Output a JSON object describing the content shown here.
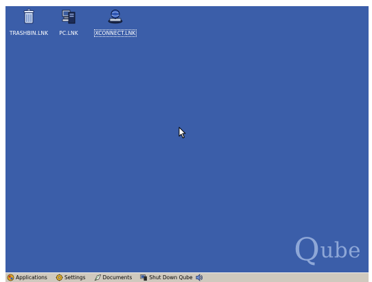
{
  "desktop": {
    "background_color": "#3b5ea9",
    "brand_text_q": "Q",
    "brand_text_rest": "ube",
    "icons": [
      {
        "label": "TRASHBIN.LNK",
        "icon": "trash-bin-icon"
      },
      {
        "label": "PC.LNK",
        "icon": "pc-icon"
      },
      {
        "label": "XCONNECT.LNK",
        "icon": "network-connect-icon",
        "selected": true
      }
    ]
  },
  "taskbar": {
    "items": [
      {
        "label": "Applications",
        "icon": "applications-icon"
      },
      {
        "label": "Settings",
        "icon": "settings-icon"
      },
      {
        "label": "Documents",
        "icon": "documents-icon"
      },
      {
        "label": "Shut Down Qube",
        "icon": "shutdown-icon"
      }
    ],
    "tray_icon": "speaker-icon"
  }
}
